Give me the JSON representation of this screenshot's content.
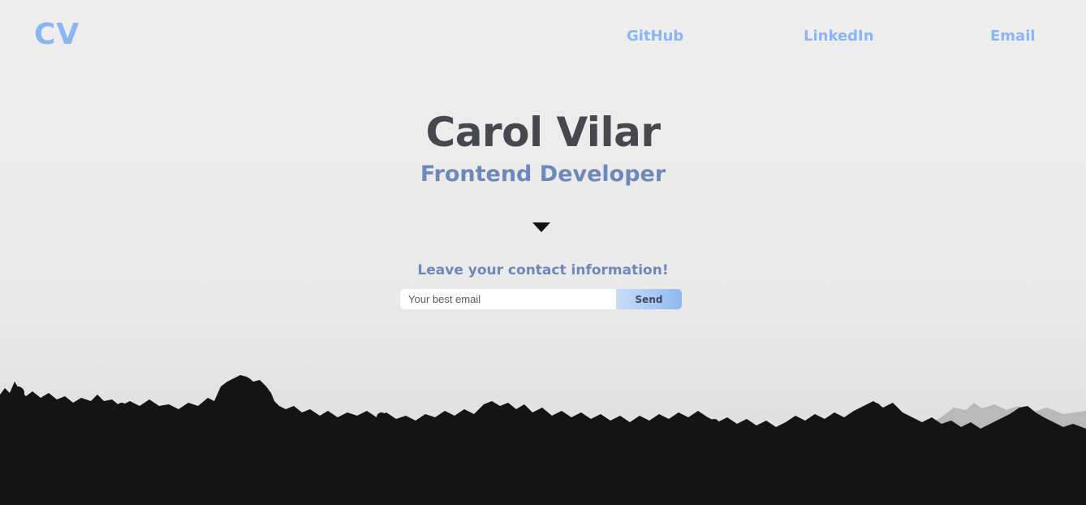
{
  "header": {
    "logo": "CV",
    "nav": {
      "github": "GitHub",
      "linkedin": "LinkedIn",
      "email": "Email"
    }
  },
  "hero": {
    "name": "Carol Vilar",
    "role": "Frontend Developer",
    "scroll_icon": "caret-down-icon"
  },
  "contact": {
    "title": "Leave your contact information!",
    "email_placeholder": "Your best email",
    "email_value": "",
    "send_label": "Send"
  },
  "colors": {
    "accent": "#8ab6f5",
    "name_text": "#47474f",
    "subtitle_text": "#6d89ba",
    "forest": "#141414"
  }
}
